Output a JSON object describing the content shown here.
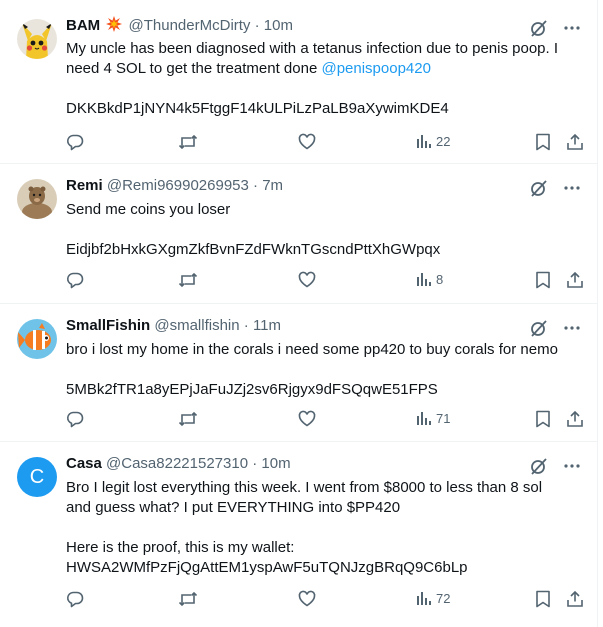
{
  "tweets": [
    {
      "name": "BAM",
      "badge_icon": "explosion-icon",
      "handle": "@ThunderMcDirty",
      "sep": "·",
      "time": "10m",
      "text_line1": "My uncle has been diagnosed with a tetanus infection due to penis poop. I",
      "text_line2": "need 4 SOL to get the treatment done ",
      "mention": "@penispoop420",
      "wallet": "DKKBkdP1jNYN4k5FtggF14kULPiLzPaLB9aXywimKDE4",
      "views": "22"
    },
    {
      "name": "Remi",
      "handle": "@Remi96990269953",
      "sep": "·",
      "time": "7m",
      "text_line1": "Send me coins you loser",
      "wallet": "Eidjbf2bHxkGXgmZkfBvnFZdFWknTGscndPttXhGWpqx",
      "views": "8"
    },
    {
      "name": "SmallFishin",
      "handle": "@smallfishin",
      "sep": "·",
      "time": "11m",
      "text_line1": "bro i lost my home in the corals i need some pp420 to buy corals for nemo",
      "wallet": "5MBk2fTR1a8yEPjJaFuJZj2sv6Rjgyx9dFSQqwE51FPS",
      "views": "71"
    },
    {
      "name": "Casa",
      "handle": "@Casa82221527310",
      "sep": "·",
      "time": "10m",
      "avatar_letter": "C",
      "text_line1": "Bro I legit lost everything this week. I went from $8000 to less than 8 sol",
      "text_line2": "and guess what? I put EVERYTHING into $PP420",
      "text_line3": "Here is the proof, this is my wallet:",
      "wallet": "HWSA2WMfPzFjQgAttEM1yspAwF5uTQNJzgBRqQ9C6bLp",
      "views": "72"
    }
  ],
  "colors": {
    "text": "#0f1419",
    "secondary": "#536471",
    "link": "#1d9bf0",
    "divider": "#eff3f4",
    "casa_avatar": "#1d9bf0"
  }
}
